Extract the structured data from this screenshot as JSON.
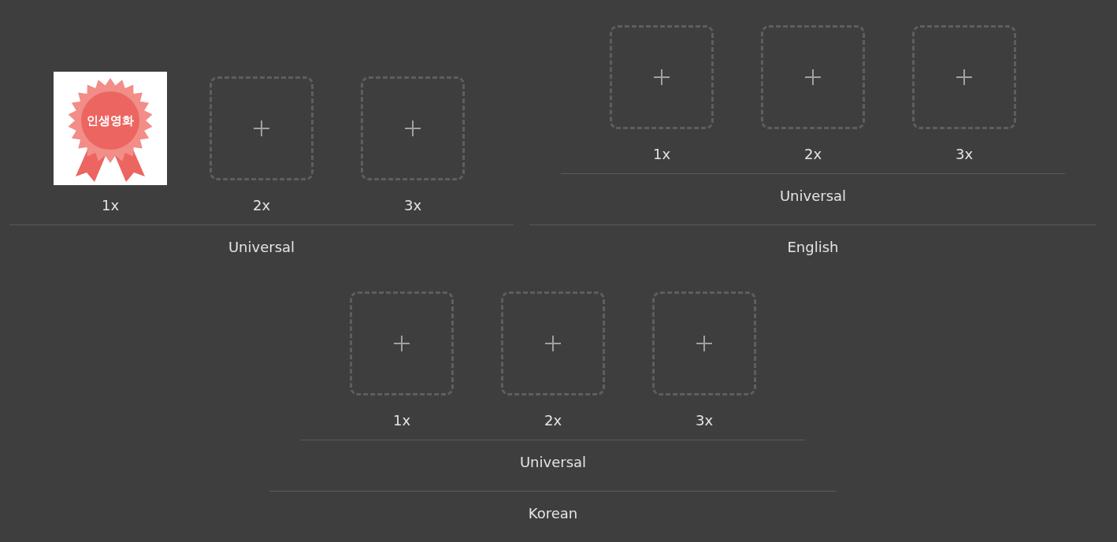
{
  "rows": [
    {
      "sets": [
        {
          "label": "Universal",
          "slots": [
            {
              "scale": "1x",
              "kind": "image",
              "badge_text": "인생영화"
            },
            {
              "scale": "2x",
              "kind": "empty"
            },
            {
              "scale": "3x",
              "kind": "empty"
            }
          ]
        },
        {
          "label": "English",
          "children": {
            "label": "Universal",
            "slots": [
              {
                "scale": "1x",
                "kind": "empty"
              },
              {
                "scale": "2x",
                "kind": "empty"
              },
              {
                "scale": "3x",
                "kind": "empty"
              }
            ]
          }
        }
      ]
    },
    {
      "sets": [
        {
          "label": "Korean",
          "children": {
            "label": "Universal",
            "slots": [
              {
                "scale": "1x",
                "kind": "empty"
              },
              {
                "scale": "2x",
                "kind": "empty"
              },
              {
                "scale": "3x",
                "kind": "empty"
              }
            ]
          }
        }
      ]
    }
  ]
}
